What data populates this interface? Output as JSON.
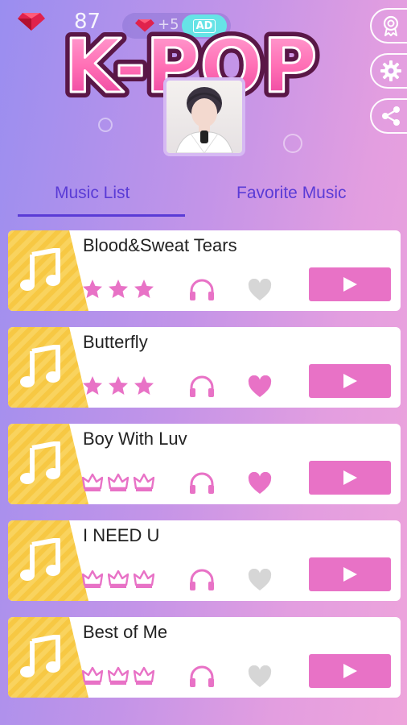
{
  "header": {
    "gem_count": "87",
    "reward_amount": "+5",
    "ad_label": "AD",
    "logo_text": "K-POP"
  },
  "side_buttons": [
    {
      "icon": "award-icon"
    },
    {
      "icon": "gear-icon"
    },
    {
      "icon": "share-icon"
    }
  ],
  "tabs": [
    {
      "label": "Music List",
      "active": true
    },
    {
      "label": "Favorite Music",
      "active": false
    }
  ],
  "colors": {
    "accent": "#e872c6",
    "tab_text": "#5a3bd6",
    "note_panel": "#f7c843",
    "heart_on": "#e872c6",
    "heart_off": "#d6d6d6"
  },
  "songs": [
    {
      "title": "Blood&Sweat Tears",
      "rating_icon": "star",
      "rating_count": 3,
      "favorite": false
    },
    {
      "title": "Butterfly",
      "rating_icon": "star",
      "rating_count": 3,
      "favorite": true
    },
    {
      "title": "Boy With Luv",
      "rating_icon": "crown",
      "rating_count": 3,
      "favorite": true
    },
    {
      "title": "I NEED U",
      "rating_icon": "crown",
      "rating_count": 3,
      "favorite": false
    },
    {
      "title": "Best of Me",
      "rating_icon": "crown",
      "rating_count": 3,
      "favorite": false
    }
  ]
}
